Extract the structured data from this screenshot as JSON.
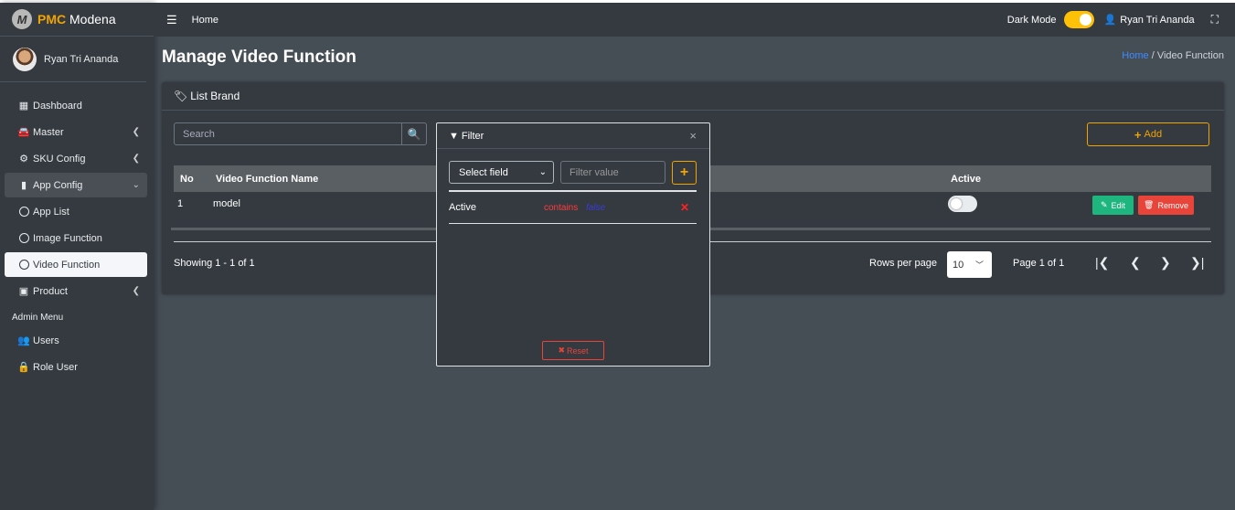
{
  "brand": {
    "logo_letter": "M",
    "name_bold": "PMC",
    "name_rest": " Modena"
  },
  "user": {
    "name": "Ryan Tri Ananda"
  },
  "sidebar": {
    "items": [
      {
        "label": "Dashboard",
        "icon": "grid-icon"
      },
      {
        "label": "Master",
        "icon": "car-icon"
      },
      {
        "label": "SKU Config",
        "icon": "gear-icon"
      },
      {
        "label": "App Config",
        "icon": "mobile-icon"
      },
      {
        "label": "App List",
        "icon": "circle-icon"
      },
      {
        "label": "Image Function",
        "icon": "circle-icon"
      },
      {
        "label": "Video Function",
        "icon": "circle-icon"
      },
      {
        "label": "Product",
        "icon": "box-icon"
      },
      {
        "label": "Users",
        "icon": "users-icon"
      },
      {
        "label": "Role User",
        "icon": "lock-icon"
      }
    ],
    "admin_header": "Admin Menu"
  },
  "topbar": {
    "home": "Home",
    "dark_mode_label": "Dark Mode",
    "user_name": "Ryan Tri Ananda"
  },
  "page": {
    "title": "Manage Video Function"
  },
  "breadcrumb": {
    "home": "Home",
    "sep": "/",
    "current": "Video Function"
  },
  "card": {
    "title": "List Brand",
    "search_placeholder": "Search",
    "add_label": "Add"
  },
  "table": {
    "headers": {
      "no": "No",
      "name": "Video Function Name",
      "active": "Active"
    },
    "rows": [
      {
        "no": "1",
        "name": "model",
        "active": false
      }
    ],
    "edit_label": "Edit",
    "remove_label": "Remove"
  },
  "footer": {
    "showing": "Showing 1 - 1 of 1",
    "rows_per_page_label": "Rows per page",
    "rows_per_page": "10",
    "page_info": "Page 1 of 1"
  },
  "filter_modal": {
    "title": "Filter",
    "select_field": "Select field",
    "filter_placeholder": "Filter value",
    "filters": [
      {
        "field": "Active",
        "op": "contains",
        "value": "false"
      }
    ],
    "reset_label": "Reset"
  },
  "colors": {
    "accent": "#f0a400",
    "edit": "#1fb57e",
    "remove": "#e8443a",
    "link": "#3f8cff"
  }
}
